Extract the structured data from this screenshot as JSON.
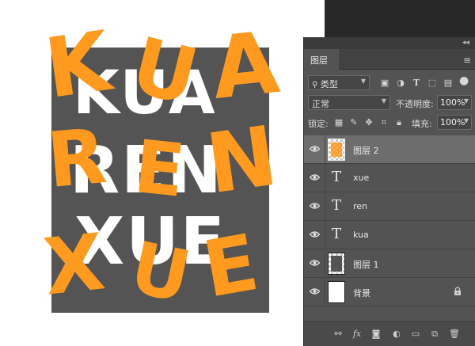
{
  "canvas": {
    "ghost_lines": [
      "KUA",
      "REN",
      "XUE"
    ],
    "orange_letters": [
      "K",
      "U",
      "A",
      "R",
      "E",
      "N",
      "X",
      "U",
      "E"
    ],
    "orange_color": "#FF9A1F",
    "gray_color": "#545454"
  },
  "panel": {
    "tab_label": "图层",
    "filter": {
      "label": "类型",
      "icon": "search-icon"
    },
    "blend_mode": "正常",
    "opacity_label": "不透明度:",
    "opacity_value": "100%",
    "lock_label": "锁定:",
    "fill_label": "填充:",
    "fill_value": "100%",
    "layers": [
      {
        "name": "图层 2",
        "type": "raster",
        "selected": true
      },
      {
        "name": "xue",
        "type": "text",
        "selected": false
      },
      {
        "name": "ren",
        "type": "text",
        "selected": false
      },
      {
        "name": "kua",
        "type": "text",
        "selected": false
      },
      {
        "name": "图层 1",
        "type": "raster",
        "selected": false
      },
      {
        "name": "背景",
        "type": "background",
        "locked": true,
        "selected": false
      }
    ],
    "bottom_icons": [
      "link-icon",
      "fx-icon",
      "mask-icon",
      "adjustment-icon",
      "group-folder-icon",
      "new-layer-icon",
      "trash-icon"
    ],
    "fx_label": "fx"
  }
}
